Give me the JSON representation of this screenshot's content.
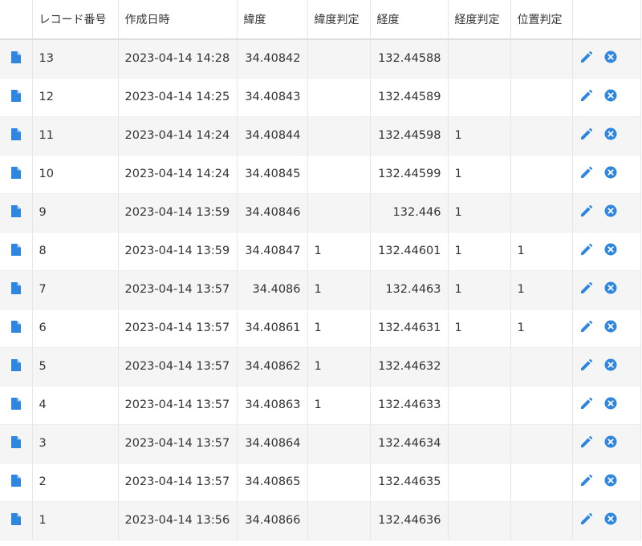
{
  "colors": {
    "accent": "#2e86de",
    "stripe": "#f5f5f5",
    "border": "#e6e6e6"
  },
  "table": {
    "headers": {
      "icon": "",
      "id": "レコード番号",
      "created": "作成日時",
      "lat": "緯度",
      "lat_judge": "緯度判定",
      "lng": "経度",
      "lng_judge": "経度判定",
      "pos_judge": "位置判定",
      "actions": ""
    },
    "row_icons": {
      "view": "document-icon",
      "edit": "pencil-icon",
      "delete": "close-circle-icon"
    },
    "rows": [
      {
        "id": "13",
        "created": "2023-04-14 14:28",
        "lat": "34.40842",
        "lat_judge": "",
        "lng": "132.44588",
        "lng_judge": "",
        "pos_judge": ""
      },
      {
        "id": "12",
        "created": "2023-04-14 14:25",
        "lat": "34.40843",
        "lat_judge": "",
        "lng": "132.44589",
        "lng_judge": "",
        "pos_judge": ""
      },
      {
        "id": "11",
        "created": "2023-04-14 14:24",
        "lat": "34.40844",
        "lat_judge": "",
        "lng": "132.44598",
        "lng_judge": "1",
        "pos_judge": ""
      },
      {
        "id": "10",
        "created": "2023-04-14 14:24",
        "lat": "34.40845",
        "lat_judge": "",
        "lng": "132.44599",
        "lng_judge": "1",
        "pos_judge": ""
      },
      {
        "id": "9",
        "created": "2023-04-14 13:59",
        "lat": "34.40846",
        "lat_judge": "",
        "lng": "132.446",
        "lng_judge": "1",
        "pos_judge": ""
      },
      {
        "id": "8",
        "created": "2023-04-14 13:59",
        "lat": "34.40847",
        "lat_judge": "1",
        "lng": "132.44601",
        "lng_judge": "1",
        "pos_judge": "1"
      },
      {
        "id": "7",
        "created": "2023-04-14 13:57",
        "lat": "34.4086",
        "lat_judge": "1",
        "lng": "132.4463",
        "lng_judge": "1",
        "pos_judge": "1"
      },
      {
        "id": "6",
        "created": "2023-04-14 13:57",
        "lat": "34.40861",
        "lat_judge": "1",
        "lng": "132.44631",
        "lng_judge": "1",
        "pos_judge": "1"
      },
      {
        "id": "5",
        "created": "2023-04-14 13:57",
        "lat": "34.40862",
        "lat_judge": "1",
        "lng": "132.44632",
        "lng_judge": "",
        "pos_judge": ""
      },
      {
        "id": "4",
        "created": "2023-04-14 13:57",
        "lat": "34.40863",
        "lat_judge": "1",
        "lng": "132.44633",
        "lng_judge": "",
        "pos_judge": ""
      },
      {
        "id": "3",
        "created": "2023-04-14 13:57",
        "lat": "34.40864",
        "lat_judge": "",
        "lng": "132.44634",
        "lng_judge": "",
        "pos_judge": ""
      },
      {
        "id": "2",
        "created": "2023-04-14 13:57",
        "lat": "34.40865",
        "lat_judge": "",
        "lng": "132.44635",
        "lng_judge": "",
        "pos_judge": ""
      },
      {
        "id": "1",
        "created": "2023-04-14 13:56",
        "lat": "34.40866",
        "lat_judge": "",
        "lng": "132.44636",
        "lng_judge": "",
        "pos_judge": ""
      }
    ]
  }
}
